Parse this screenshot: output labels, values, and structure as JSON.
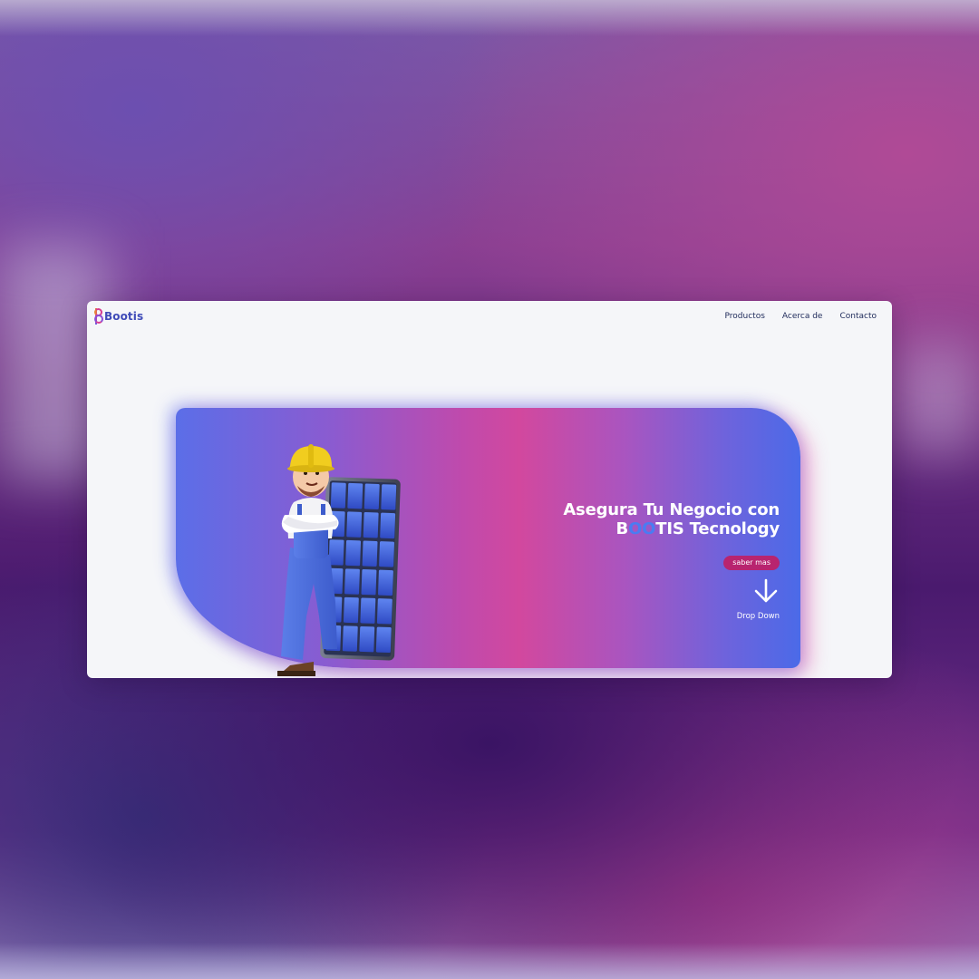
{
  "page": {
    "background_colors": [
      "#6c4fb0",
      "#b04a96",
      "#3a1464"
    ]
  },
  "header": {
    "logo_text": "Bootis",
    "logo_icon": "bootis-logo-icon",
    "nav_items": [
      {
        "label": "Productos"
      },
      {
        "label": "Acerca de"
      },
      {
        "label": "Contacto"
      }
    ]
  },
  "hero": {
    "title_line1": "Asegura Tu Negocio con",
    "title_line2_prefix": "B",
    "title_line2_highlight": "OO",
    "title_line2_suffix": "TIS Tecnology",
    "cta_label": "saber mas",
    "drop_label": "Drop Down",
    "drop_icon": "arrow-down-icon",
    "illustration": "worker-with-solar-panel-illustration",
    "colors": {
      "gradient_start": "#5b6ee8",
      "gradient_mid": "#d2489e",
      "gradient_end": "#4b6ae8",
      "cta": "#b8246f",
      "brand_highlight": "#4a7cf2"
    }
  }
}
